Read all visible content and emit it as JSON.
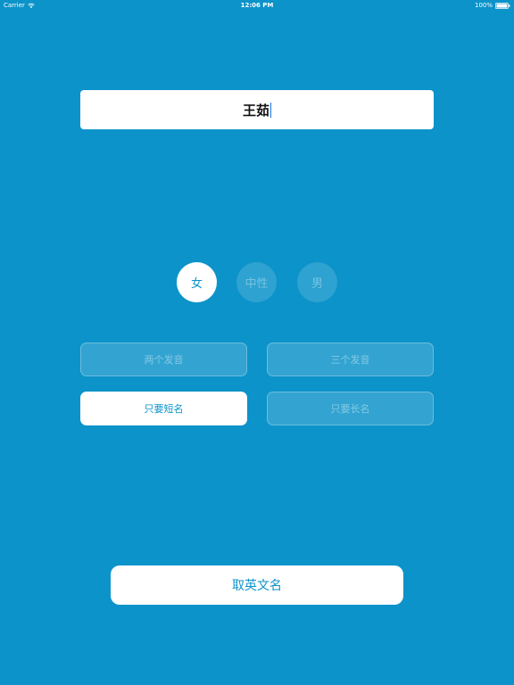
{
  "status_bar": {
    "carrier": "Carrier",
    "time": "12:06 PM",
    "battery": "100%"
  },
  "name_field": {
    "value": "王茹"
  },
  "gender": {
    "options": [
      "女",
      "中性",
      "男"
    ],
    "selected": "女"
  },
  "options": {
    "two_syllables": "两个发音",
    "three_syllables": "三个发音",
    "short_only": "只要短名",
    "long_only": "只要长名",
    "selected": "只要短名"
  },
  "submit": {
    "label": "取英文名"
  },
  "colors": {
    "background": "#0c93c9",
    "accent": "#0c93c9",
    "surface": "#ffffff"
  }
}
